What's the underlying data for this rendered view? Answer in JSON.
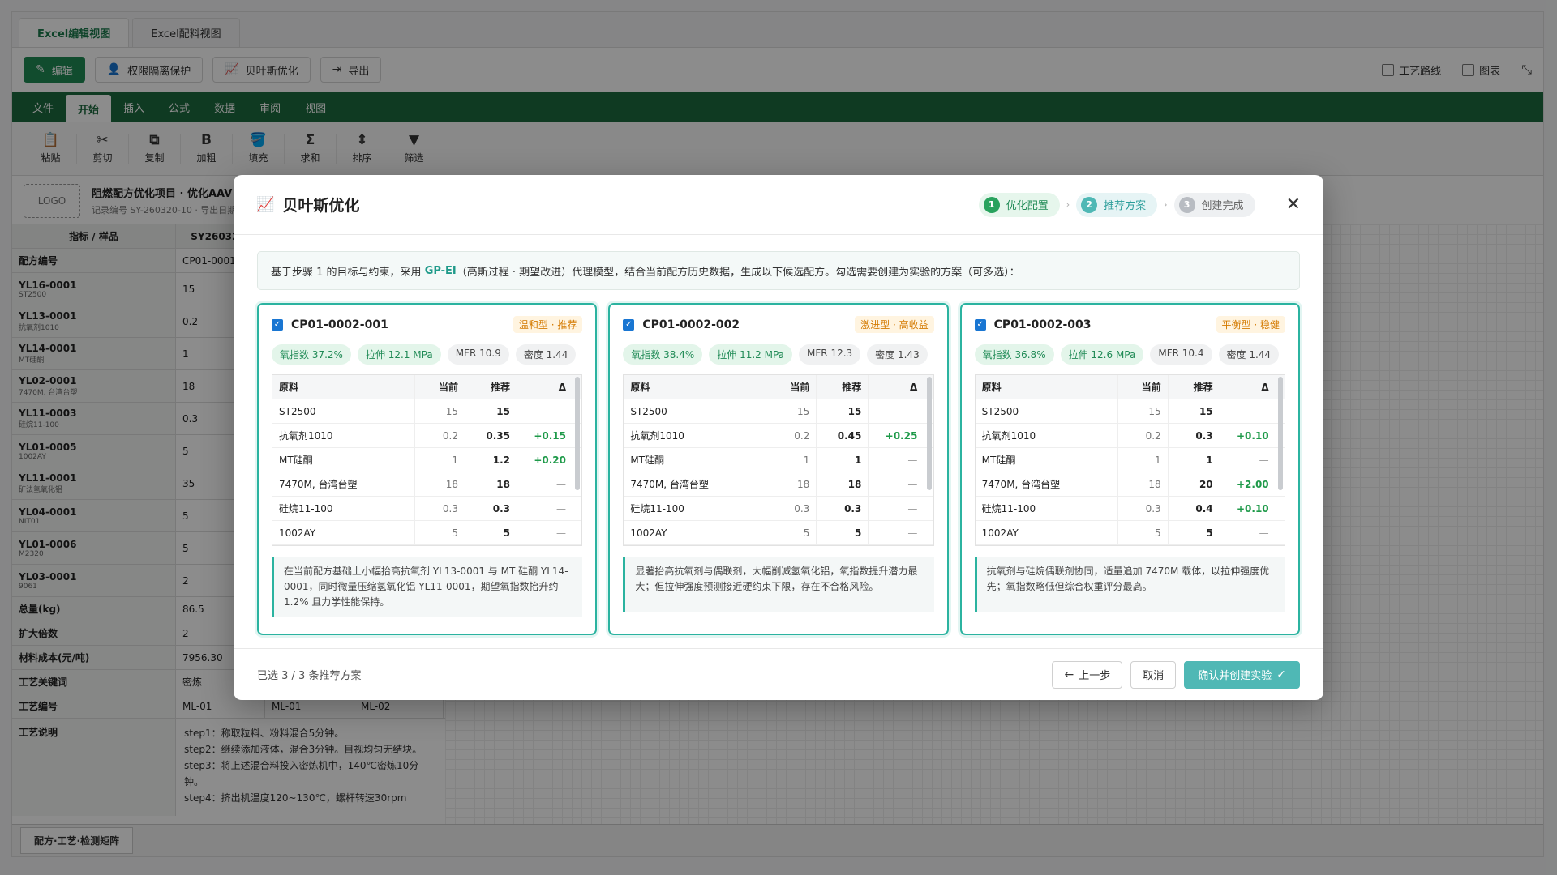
{
  "view_tabs": [
    "Excel编辑视图",
    "Excel配料视图"
  ],
  "toolbar": {
    "edit": "编辑",
    "permission": "权限隔离保护",
    "bayes": "贝叶斯优化",
    "export": "导出",
    "process_route": "工艺路线",
    "chart": "图表"
  },
  "menu": [
    "文件",
    "开始",
    "插入",
    "公式",
    "数据",
    "审阅",
    "视图"
  ],
  "ribbon": [
    "粘贴",
    "剪切",
    "复制",
    "加粗",
    "填充",
    "求和",
    "排序",
    "筛选"
  ],
  "project": {
    "logo": "LOGO",
    "title": "阻燃配方优化项目 · 优化AAV",
    "subtitle": "记录编号 SY-260320-10 · 导出日期"
  },
  "grid": {
    "header": [
      "指标 / 样品",
      "SY260320-"
    ],
    "rows": [
      {
        "key": "配方编号",
        "sub": "",
        "val": "CP01-0001"
      },
      {
        "key": "YL16-0001",
        "sub": "ST2500",
        "val": "15"
      },
      {
        "key": "YL13-0001",
        "sub": "抗氧剂1010",
        "val": "0.2"
      },
      {
        "key": "YL14-0001",
        "sub": "MT硅酮",
        "val": "1"
      },
      {
        "key": "YL02-0001",
        "sub": "7470M, 台湾台塑",
        "val": "18"
      },
      {
        "key": "YL11-0003",
        "sub": "硅烷11-100",
        "val": "0.3"
      },
      {
        "key": "YL01-0005",
        "sub": "1002AY",
        "val": "5"
      },
      {
        "key": "YL11-0001",
        "sub": "矿法氢氧化铝",
        "val": "35"
      },
      {
        "key": "YL04-0001",
        "sub": "NIT01",
        "val": "5"
      },
      {
        "key": "YL01-0006",
        "sub": "M2320",
        "val": "5"
      },
      {
        "key": "YL03-0001",
        "sub": "9061",
        "val": "2"
      },
      {
        "key": "总量(kg)",
        "sub": "",
        "val": "86.5"
      },
      {
        "key": "扩大倍数",
        "sub": "",
        "val": "2"
      },
      {
        "key": "材料成本(元/吨)",
        "sub": "",
        "val": "7956.30"
      },
      {
        "key": "工艺关键词",
        "sub": "",
        "val": "密炼"
      }
    ],
    "craft_no": {
      "key": "工艺编号",
      "vals": [
        "ML-01",
        "ML-01",
        "ML-02"
      ]
    },
    "craft_desc": {
      "key": "工艺说明",
      "lines": [
        "step1：称取粒料、粉料混合5分钟。",
        "step2：继续添加液体，混合3分钟。目视均匀无结块。",
        "step3：将上述混合料投入密炼机中，140℃密炼10分钟。",
        "step4：挤出机温度120~130℃，螺杆转速30rpm"
      ]
    }
  },
  "sheet_tab": "配方·工艺·检测矩阵",
  "modal": {
    "title": "贝叶斯优化",
    "steps": [
      {
        "num": "1",
        "label": "优化配置"
      },
      {
        "num": "2",
        "label": "推荐方案"
      },
      {
        "num": "3",
        "label": "创建完成"
      }
    ],
    "intro_before": "基于步骤 1 的目标与约束，采用",
    "intro_model": "GP-EI",
    "intro_after": "（高斯过程 · 期望改进）代理模型，结合当前配方历史数据，生成以下候选配方。勾选需要创建为实验的方案（可多选）：",
    "table_header": [
      "原料",
      "当前",
      "推荐",
      "Δ"
    ],
    "cards": [
      {
        "name": "CP01-0002-001",
        "tag": "温和型 · 推荐",
        "metrics": [
          "氧指数 37.2%",
          "拉伸 12.1 MPa",
          "MFR 10.9",
          "密度 1.44"
        ],
        "rows": [
          [
            "ST2500",
            "15",
            "15",
            "—"
          ],
          [
            "抗氧剂1010",
            "0.2",
            "0.35",
            "+0.15"
          ],
          [
            "MT硅酮",
            "1",
            "1.2",
            "+0.20"
          ],
          [
            "7470M, 台湾台塑",
            "18",
            "18",
            "—"
          ],
          [
            "硅烷11-100",
            "0.3",
            "0.3",
            "—"
          ],
          [
            "1002AY",
            "5",
            "5",
            "—"
          ]
        ],
        "note": "在当前配方基础上小幅抬高抗氧剂 YL13-0001 与 MT 硅酮 YL14-0001，同时微量压缩氢氧化铝 YL11-0001，期望氧指数抬升约 1.2% 且力学性能保持。"
      },
      {
        "name": "CP01-0002-002",
        "tag": "激进型 · 高收益",
        "metrics": [
          "氧指数 38.4%",
          "拉伸 11.2 MPa",
          "MFR 12.3",
          "密度 1.43"
        ],
        "rows": [
          [
            "ST2500",
            "15",
            "15",
            "—"
          ],
          [
            "抗氧剂1010",
            "0.2",
            "0.45",
            "+0.25"
          ],
          [
            "MT硅酮",
            "1",
            "1",
            "—"
          ],
          [
            "7470M, 台湾台塑",
            "18",
            "18",
            "—"
          ],
          [
            "硅烷11-100",
            "0.3",
            "0.3",
            "—"
          ],
          [
            "1002AY",
            "5",
            "5",
            "—"
          ]
        ],
        "note": "显著抬高抗氧剂与偶联剂，大幅削减氢氧化铝，氧指数提升潜力最大；但拉伸强度预测接近硬约束下限，存在不合格风险。"
      },
      {
        "name": "CP01-0002-003",
        "tag": "平衡型 · 稳健",
        "metrics": [
          "氧指数 36.8%",
          "拉伸 12.6 MPa",
          "MFR 10.4",
          "密度 1.44"
        ],
        "rows": [
          [
            "ST2500",
            "15",
            "15",
            "—"
          ],
          [
            "抗氧剂1010",
            "0.2",
            "0.3",
            "+0.10"
          ],
          [
            "MT硅酮",
            "1",
            "1",
            "—"
          ],
          [
            "7470M, 台湾台塑",
            "18",
            "20",
            "+2.00"
          ],
          [
            "硅烷11-100",
            "0.3",
            "0.4",
            "+0.10"
          ],
          [
            "1002AY",
            "5",
            "5",
            "—"
          ]
        ],
        "note": "抗氧剂与硅烷偶联剂协同，适量追加 7470M 载体，以拉伸强度优先；氧指数略低但综合权重评分最高。"
      }
    ],
    "selected": "已选 3 / 3 条推荐方案",
    "prev": "上一步",
    "cancel": "取消",
    "confirm": "确认并创建实验"
  },
  "colors": {
    "brand_green": "#1d6a3f",
    "accent_teal": "#2bb3a0",
    "primary_button": "#4fb8b5",
    "tag_orange": "#d47a00"
  }
}
